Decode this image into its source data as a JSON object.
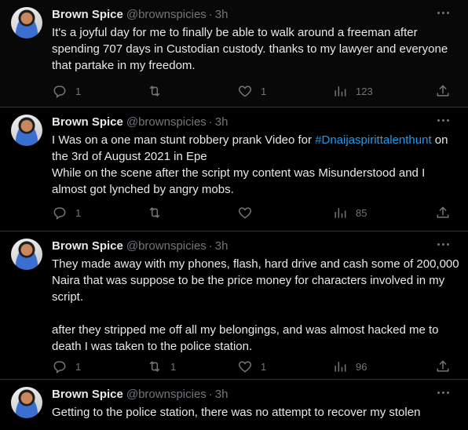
{
  "tweets": [
    {
      "name": "Brown Spice",
      "handle": "@brownspicies",
      "time": "3h",
      "text": "It's a joyful day for me to finally be able to walk around a freeman after spending 707 days in Custodian custody. thanks to my lawyer and everyone that partake in my freedom.",
      "replies": "1",
      "retweets": "",
      "likes": "1",
      "views": "123"
    },
    {
      "name": "Brown Spice",
      "handle": "@brownspicies",
      "time": "3h",
      "text_before": "I Was on a one man stunt robbery prank Video for ",
      "hashtag": "#Dnaijaspirittalenthunt",
      "text_after": " on the 3rd of August 2021 in Epe\nWhile on the scene after the script my content was Misunderstood and I almost got lynched by angry mobs.",
      "replies": "1",
      "retweets": "",
      "likes": "",
      "views": "85"
    },
    {
      "name": "Brown Spice",
      "handle": "@brownspicies",
      "time": "3h",
      "text": "They made away with my phones, flash, hard drive and cash some of 200,000 Naira that was suppose to be the price money for characters involved in my script.\n\nafter they stripped me off all my belongings, and was almost hacked me to death I was taken to the police station.",
      "replies": "1",
      "retweets": "1",
      "likes": "1",
      "views": "96"
    },
    {
      "name": "Brown Spice",
      "handle": "@brownspicies",
      "time": "3h",
      "text": "Getting to the police station, there was no attempt to recover my stolen"
    }
  ],
  "separator": "·",
  "icons": {
    "more": "more-horizontal-icon",
    "reply": "reply-icon",
    "retweet": "retweet-icon",
    "like": "heart-icon",
    "views": "views-chart-icon",
    "share": "share-icon"
  },
  "colors": {
    "background": "#000000",
    "text": "#e7e9ea",
    "muted": "#71767b",
    "link": "#1d9bf0",
    "divider": "#2f3336"
  }
}
